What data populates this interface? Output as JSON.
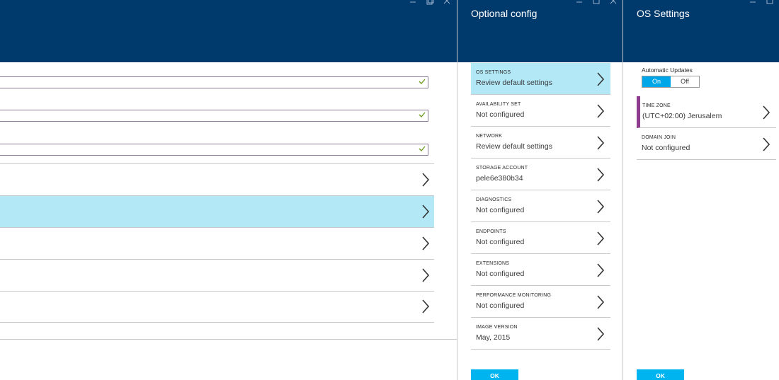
{
  "blades": {
    "optional": {
      "title": "Optional config",
      "items": [
        {
          "label": "OS SETTINGS",
          "value": "Review default settings"
        },
        {
          "label": "AVAILABILITY SET",
          "value": "Not configured"
        },
        {
          "label": "NETWORK",
          "value": "Review default settings"
        },
        {
          "label": "STORAGE ACCOUNT",
          "value": "pele6e380b34"
        },
        {
          "label": "DIAGNOSTICS",
          "value": "Not configured"
        },
        {
          "label": "ENDPOINTS",
          "value": "Not configured"
        },
        {
          "label": "EXTENSIONS",
          "value": "Not configured"
        },
        {
          "label": "PERFORMANCE MONITORING",
          "value": "Not configured"
        },
        {
          "label": "IMAGE VERSION",
          "value": "May, 2015"
        }
      ],
      "ok_label": "OK"
    },
    "os_settings": {
      "title": "OS Settings",
      "automatic_updates_label": "Automatic Updates",
      "toggle": {
        "on": "On",
        "off": "Off",
        "selected": "On"
      },
      "items": [
        {
          "label": "TIME ZONE",
          "value": "(UTC+02:00) Jerusalem"
        },
        {
          "label": "DOMAIN JOIN",
          "value": "Not configured"
        }
      ],
      "ok_label": "OK"
    }
  },
  "colors": {
    "header": "#003a6c",
    "selected_row": "#b3e8f7",
    "ok_button": "#00b4f0",
    "toggle_active": "#00a7e8",
    "accent_bar": "#8e3c8e",
    "check": "#6a9a1a"
  },
  "icons": {
    "chevron": "chevron-right-icon",
    "check": "check-icon",
    "minimize": "minimize-icon",
    "restore": "restore-icon",
    "close": "close-icon"
  }
}
